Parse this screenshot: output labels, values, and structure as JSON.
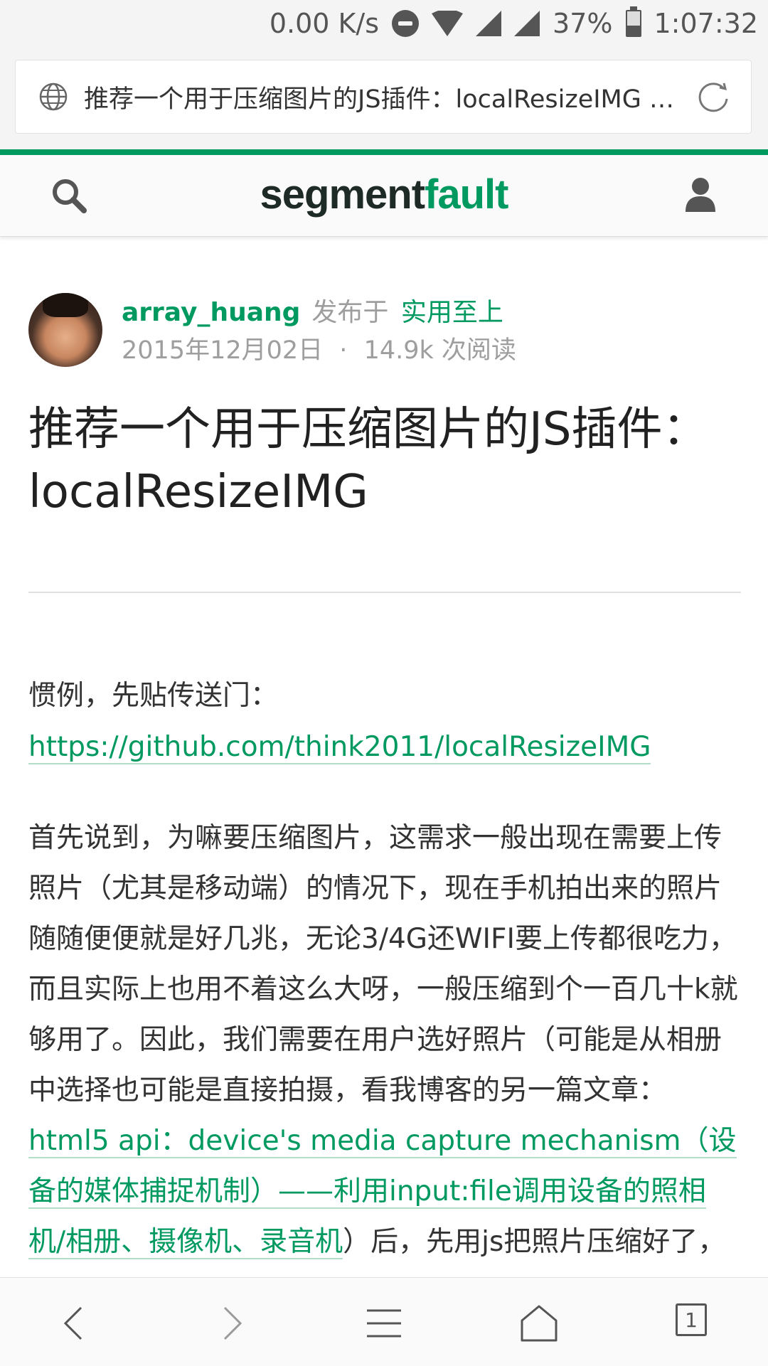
{
  "status_bar": {
    "network_speed": "0.00 K/s",
    "battery": "37%",
    "time": "1:07:32"
  },
  "browser": {
    "page_title": "推荐一个用于压缩图片的JS插件：localResizeIMG -...",
    "icons": {
      "site": "globe-icon",
      "reload": "reload-icon"
    },
    "tab_count": "1"
  },
  "site": {
    "logo_part1": "segment",
    "logo_part2": "fault",
    "accent_color": "#009a61"
  },
  "article": {
    "author": "array_huang",
    "published_in": "发布于",
    "column": "实用至上",
    "date": "2015年12月02日",
    "separator": "·",
    "reads": "14.9k 次阅读",
    "title": "推荐一个用于压缩图片的JS插件：localResizeIMG",
    "para1_text": "惯例，先贴传送门：",
    "para1_link": "https://github.com/think2011/localResizeIMG",
    "para2_text": "首先说到，为嘛要压缩图片，这需求一般出现在需要上传照片（尤其是移动端）的情况下，现在手机拍出来的照片随随便便就是好几兆，无论3/4G还WIFI要上传都很吃力，而且实际上也用不着这么大呀，一般压缩到个一百几十k就够用了。因此，我们需要在用户选好照片（可能是从相册中选择也可能是直接拍摄，看我博客的另一篇文章：",
    "para2_link": "html5 api：device's media capture mechanism（设备的媒体捕捉机制）——利用input:file调用设备的照相机/相册、摄像机、录音机",
    "para2_tail": "）后，先用js把照片压缩好了，再上"
  }
}
